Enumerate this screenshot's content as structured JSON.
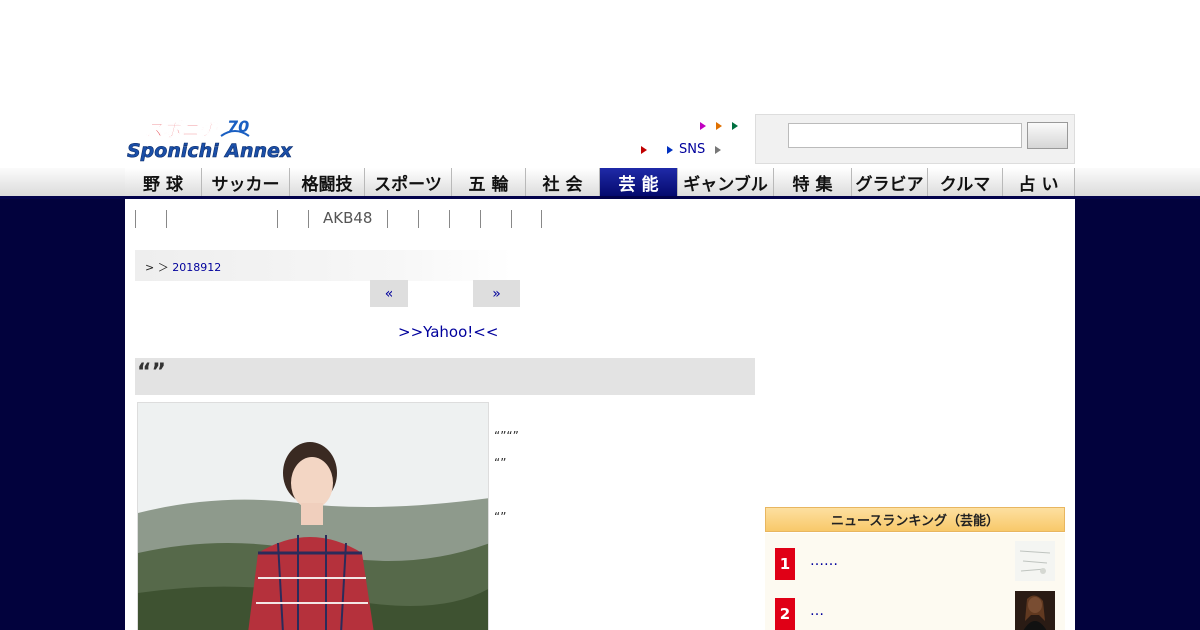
{
  "header": {
    "logo_text_top": "スポニチ",
    "logo_text_bottom": "Sponichi Annex",
    "logo_badge": "70",
    "sns_label": "SNS",
    "search": {
      "value": "",
      "placeholder": ""
    }
  },
  "nav": {
    "items": [
      {
        "label": "野 球",
        "active": false
      },
      {
        "label": "サッカー",
        "active": false
      },
      {
        "label": "格闘技",
        "active": false
      },
      {
        "label": "スポーツ",
        "active": false
      },
      {
        "label": "五 輪",
        "active": false
      },
      {
        "label": "社 会",
        "active": false
      },
      {
        "label": "芸 能",
        "active": true
      },
      {
        "label": "ギャンブル",
        "active": false
      },
      {
        "label": "特 集",
        "active": false
      },
      {
        "label": "グラビア",
        "active": false
      },
      {
        "label": "クルマ",
        "active": false
      },
      {
        "label": "占 い",
        "active": false
      }
    ]
  },
  "subnav": {
    "akb": "AKB48"
  },
  "breadcrumb": {
    "prefix": "> ＞",
    "date": "2018912"
  },
  "pager": {
    "prev": "«",
    "next": "»"
  },
  "yahoo_link": ">>Yahoo!<<",
  "article": {
    "title": "“”",
    "quote1": "“”“”",
    "quote2": "“”",
    "quote3": "“”"
  },
  "ranking": {
    "heading": "ニュースランキング（芸能）",
    "items": [
      {
        "rank": "1",
        "text": "……"
      },
      {
        "rank": "2",
        "text": "…"
      }
    ]
  },
  "colors": {
    "navy": "#02023d",
    "link": "#00009c",
    "active_tab": "#0a128a",
    "rank_red": "#e00016",
    "ranking_gold": "#f8c96a"
  }
}
